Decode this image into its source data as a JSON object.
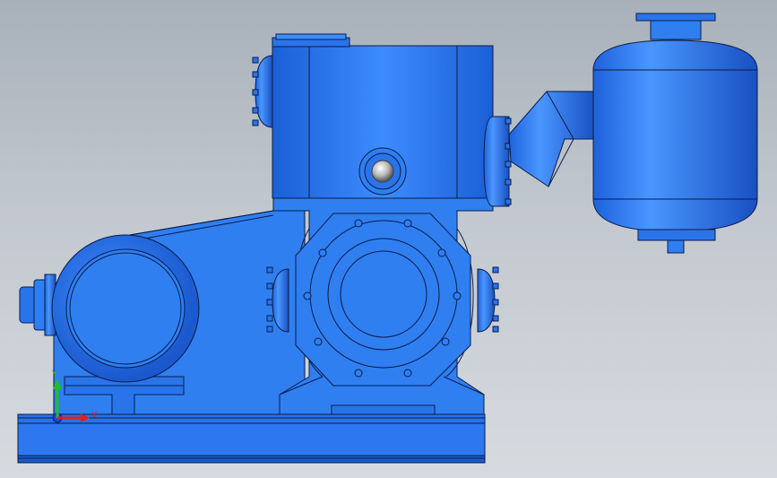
{
  "viewport": {
    "background_top": "#a8b0ba",
    "background_bottom": "#d7dbe0",
    "model_color": "#2f7ff0",
    "edge_color": "#0a1c4a"
  },
  "triad": {
    "x_label": "X",
    "y_label": "Y",
    "x_color": "#e02020",
    "y_color": "#20c020",
    "z_color": "#2040e0"
  }
}
